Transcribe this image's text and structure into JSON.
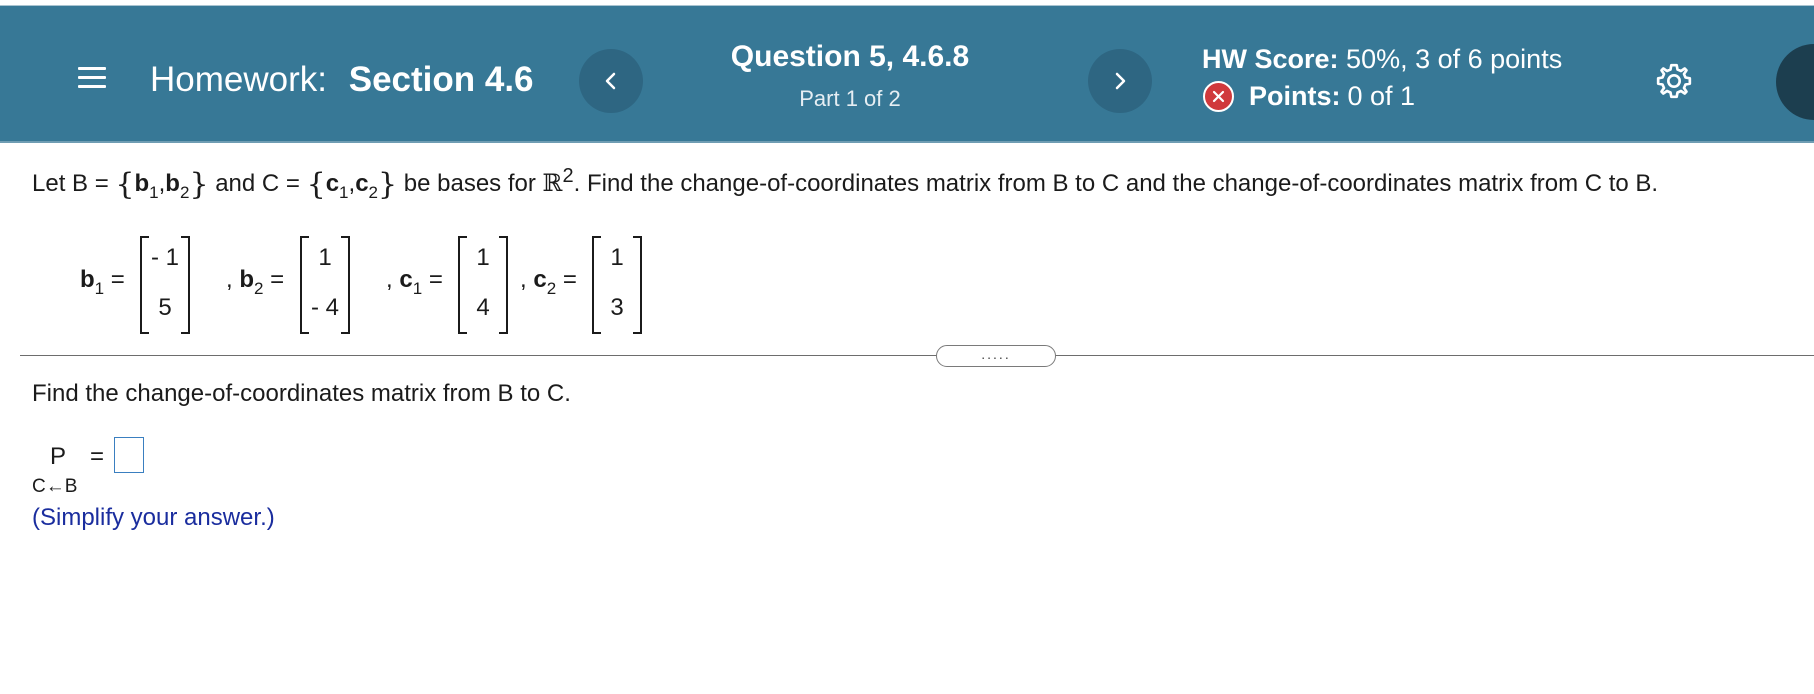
{
  "header": {
    "menu_icon": "hamburger-menu-icon",
    "homework_label": "Homework:",
    "section": "Section 4.6",
    "prev_icon": "chevron-left-icon",
    "next_icon": "chevron-right-icon",
    "question_title": "Question 5, 4.6.8",
    "question_part": "Part 1 of 2",
    "hw_score_label": "HW Score:",
    "hw_score_value": "50%, 3 of 6 points",
    "points_label": "Points:",
    "points_value": "0 of 1",
    "points_status_icon": "x-circle-icon",
    "settings_icon": "gear-icon",
    "colors": {
      "bar": "#377896",
      "nav_button": "#2e6682",
      "incorrect": "#d0393c"
    }
  },
  "problem": {
    "prompt_start": "Let B = ",
    "B_elements": [
      "b",
      "1",
      "b",
      "2"
    ],
    "prompt_and": " and C = ",
    "C_elements": [
      "c",
      "1",
      "c",
      "2"
    ],
    "prompt_bases": " be bases for ",
    "R_symbol": "ℝ",
    "R_power": "2",
    "prompt_end": ". Find the change-of-coordinates matrix from B to C and the change-of-coordinates matrix from C to B.",
    "vectors": [
      {
        "name": "b",
        "index": "1",
        "values": [
          "- 1",
          "5"
        ]
      },
      {
        "name": "b",
        "index": "2",
        "values": [
          "1",
          "- 4"
        ]
      },
      {
        "name": "c",
        "index": "1",
        "values": [
          "1",
          "4"
        ]
      },
      {
        "name": "c",
        "index": "2",
        "values": [
          "1",
          "3"
        ]
      }
    ],
    "expand_label": "....."
  },
  "part1": {
    "question": "Find the change-of-coordinates matrix from B to C.",
    "matrix_label": "P",
    "equals": "=",
    "matrix_subscript": "C←B",
    "answer_value": "",
    "hint": "(Simplify your answer.)"
  }
}
